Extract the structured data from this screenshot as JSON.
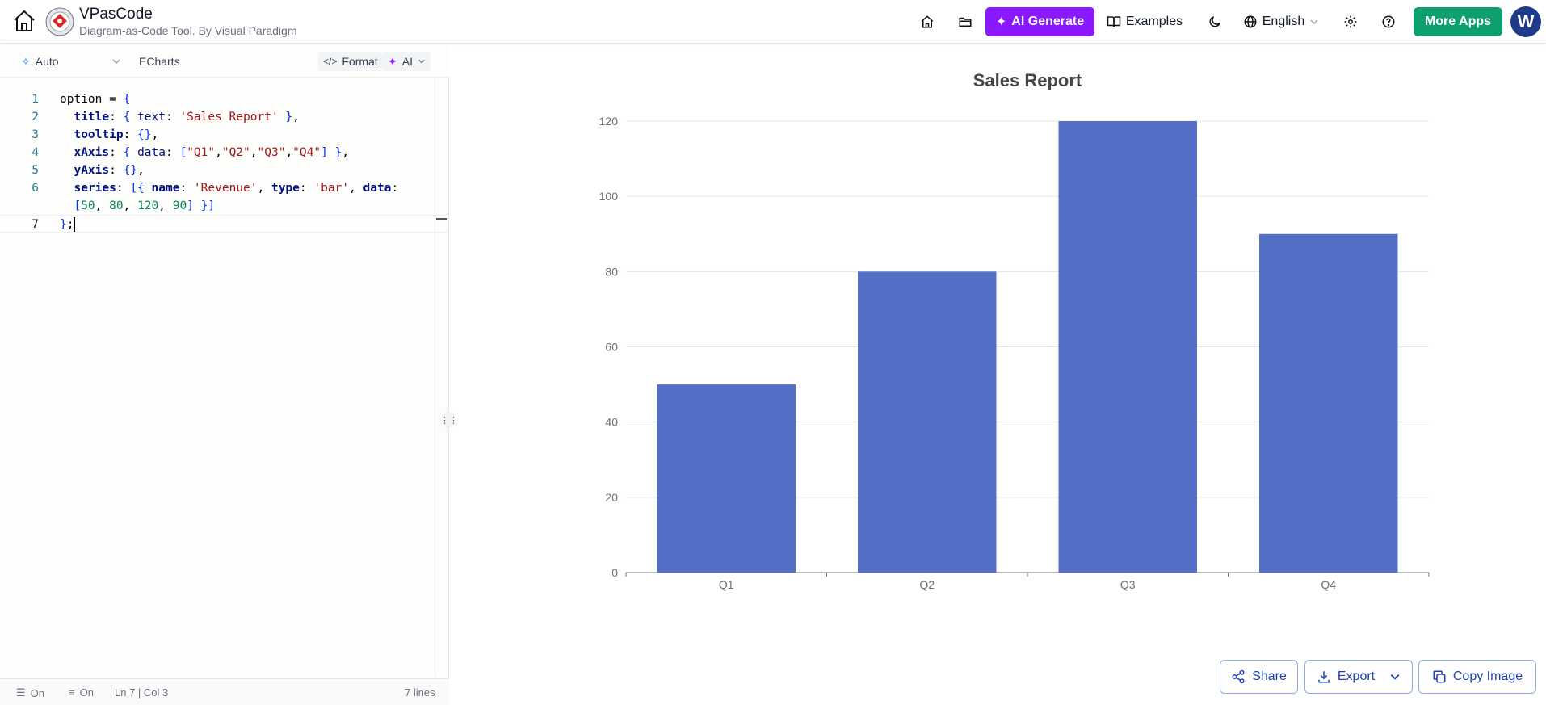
{
  "header": {
    "app_title": "VPasCode",
    "app_subtitle": "Diagram-as-Code Tool. By Visual Paradigm",
    "ai_generate_label": "AI Generate",
    "examples_label": "Examples",
    "language_label": "English",
    "more_apps_label": "More Apps",
    "avatar_initial": "W"
  },
  "editor_toolbar": {
    "mode_label": "Auto",
    "engine_label": "ECharts",
    "format_label": "Format",
    "ai_label": "AI"
  },
  "editor": {
    "lines": [
      {
        "num": "1",
        "tokens": [
          [
            "t",
            "option = "
          ],
          [
            "pl",
            "{"
          ]
        ]
      },
      {
        "num": "2",
        "tokens": [
          [
            "t",
            "  "
          ],
          [
            "kw",
            "title"
          ],
          [
            "t",
            ": "
          ],
          [
            "pl",
            "{"
          ],
          [
            "t",
            " "
          ],
          [
            "kw2",
            "text"
          ],
          [
            "t",
            ": "
          ],
          [
            "str",
            "'Sales Report'"
          ],
          [
            "t",
            " "
          ],
          [
            "pl",
            "}"
          ],
          [
            "t",
            ","
          ]
        ]
      },
      {
        "num": "3",
        "tokens": [
          [
            "t",
            "  "
          ],
          [
            "kw",
            "tooltip"
          ],
          [
            "t",
            ": "
          ],
          [
            "pl",
            "{}"
          ],
          [
            "t",
            ","
          ]
        ]
      },
      {
        "num": "4",
        "tokens": [
          [
            "t",
            "  "
          ],
          [
            "kw",
            "xAxis"
          ],
          [
            "t",
            ": "
          ],
          [
            "pl",
            "{"
          ],
          [
            "t",
            " "
          ],
          [
            "kw2",
            "data"
          ],
          [
            "t",
            ": "
          ],
          [
            "pl",
            "["
          ],
          [
            "str",
            "\"Q1\""
          ],
          [
            "t",
            ","
          ],
          [
            "str",
            "\"Q2\""
          ],
          [
            "t",
            ","
          ],
          [
            "str",
            "\"Q3\""
          ],
          [
            "t",
            ","
          ],
          [
            "str",
            "\"Q4\""
          ],
          [
            "pl",
            "]"
          ],
          [
            "t",
            " "
          ],
          [
            "pl",
            "}"
          ],
          [
            "t",
            ","
          ]
        ]
      },
      {
        "num": "5",
        "tokens": [
          [
            "t",
            "  "
          ],
          [
            "kw",
            "yAxis"
          ],
          [
            "t",
            ": "
          ],
          [
            "pl",
            "{}"
          ],
          [
            "t",
            ","
          ]
        ]
      },
      {
        "num": "6",
        "tokens": [
          [
            "t",
            "  "
          ],
          [
            "kw",
            "series"
          ],
          [
            "t",
            ": "
          ],
          [
            "pl",
            "[{"
          ],
          [
            "t",
            " "
          ],
          [
            "kw",
            "name"
          ],
          [
            "t",
            ": "
          ],
          [
            "str",
            "'Revenue'"
          ],
          [
            "t",
            ", "
          ],
          [
            "kw",
            "type"
          ],
          [
            "t",
            ": "
          ],
          [
            "str",
            "'bar'"
          ],
          [
            "t",
            ", "
          ],
          [
            "kw",
            "data"
          ],
          [
            "t",
            ":"
          ]
        ]
      },
      {
        "num": "",
        "tokens": [
          [
            "t",
            "  "
          ],
          [
            "pl",
            "["
          ],
          [
            "num",
            "50"
          ],
          [
            "t",
            ", "
          ],
          [
            "num",
            "80"
          ],
          [
            "t",
            ", "
          ],
          [
            "num",
            "120"
          ],
          [
            "t",
            ", "
          ],
          [
            "num",
            "90"
          ],
          [
            "pl",
            "]"
          ],
          [
            "t",
            " "
          ],
          [
            "pl",
            "}]"
          ]
        ]
      },
      {
        "num": "7",
        "tokens": [
          [
            "pl",
            "}"
          ],
          [
            "t",
            ";"
          ]
        ]
      }
    ]
  },
  "status_bar": {
    "left_toggle_1": "On",
    "left_toggle_2": "On",
    "position": "Ln 7 | Col 3",
    "line_count": "7 lines"
  },
  "chart_data": {
    "type": "bar",
    "title": "Sales Report",
    "categories": [
      "Q1",
      "Q2",
      "Q3",
      "Q4"
    ],
    "series": [
      {
        "name": "Revenue",
        "values": [
          50,
          80,
          120,
          90
        ]
      }
    ],
    "yticks": [
      0,
      20,
      40,
      60,
      80,
      100,
      120
    ],
    "ylim": [
      0,
      120
    ],
    "grid": true,
    "bar_color": "#5470c6"
  },
  "actions": {
    "share_label": "Share",
    "export_label": "Export",
    "copy_image_label": "Copy Image"
  },
  "colors": {
    "ai_generate_bg": "#8b19ff",
    "more_apps_bg": "#0e9f6e",
    "avatar_bg": "#1e3a8a",
    "button_text": "#1e40af"
  }
}
